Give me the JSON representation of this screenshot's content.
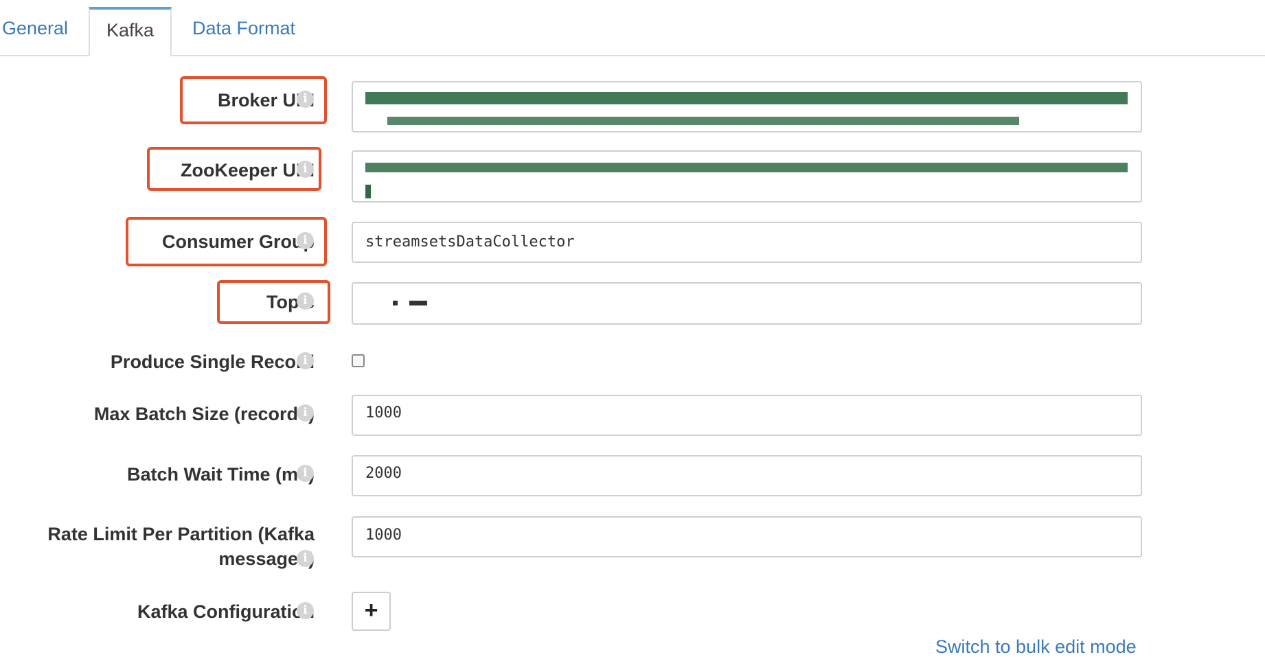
{
  "tabs": [
    {
      "label": "General"
    },
    {
      "label": "Kafka",
      "active": true
    },
    {
      "label": "Data Format"
    }
  ],
  "info_icon": "info-icon",
  "form": {
    "broker_uri": {
      "label": "Broker URI",
      "value": ""
    },
    "zookeeper_uri": {
      "label": "ZooKeeper URI",
      "value": ""
    },
    "consumer_group": {
      "label": "Consumer Group",
      "value": "streamsetsDataCollector"
    },
    "topic": {
      "label": "Topic",
      "value": ""
    },
    "produce_single_record": {
      "label": "Produce Single Record",
      "checked": false
    },
    "max_batch_size": {
      "label": "Max Batch Size (records)",
      "value": "1000"
    },
    "batch_wait_time": {
      "label": "Batch Wait Time (ms)",
      "value": "2000"
    },
    "rate_limit": {
      "label_line1": "Rate Limit Per Partition (Kafka",
      "label_line2": "messages)",
      "value": "1000"
    },
    "kafka_configuration": {
      "label": "Kafka Configuration",
      "add_button": "+"
    }
  },
  "bulk_edit_link": "Switch to bulk edit mode",
  "colors": {
    "accent": "#3a7ab8",
    "highlight": "#e4512e",
    "tab_active_top": "#5aa0d2"
  }
}
